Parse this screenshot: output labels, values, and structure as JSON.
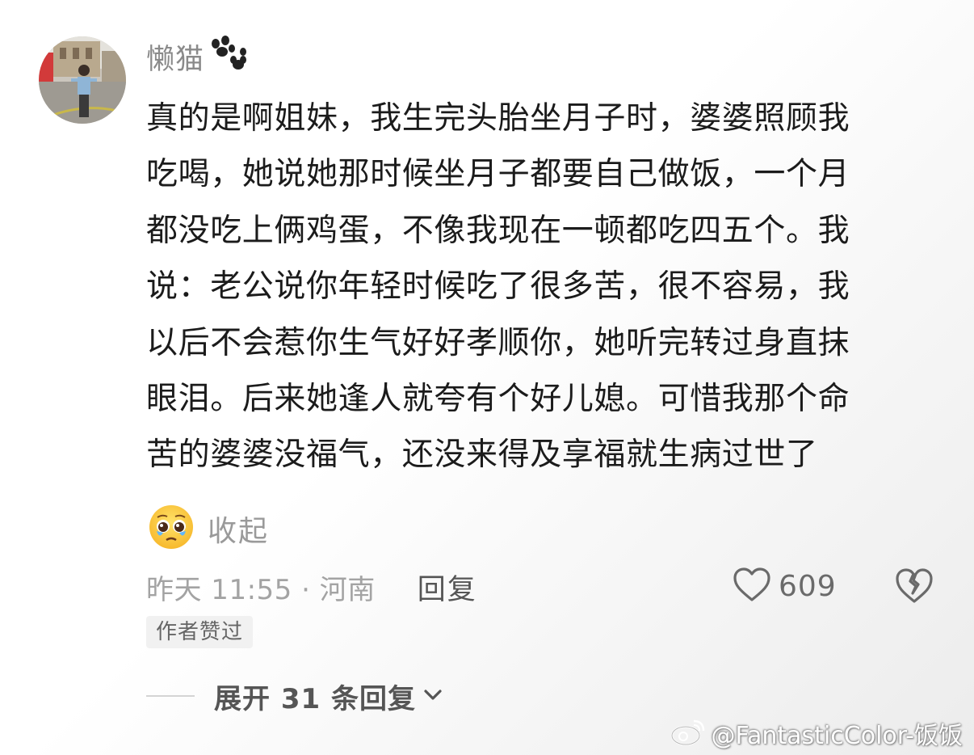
{
  "comment": {
    "username": "懒猫",
    "username_emoji": "paw-icon",
    "text_lines": [
      "真的是啊姐妹，我生完头胎坐月子时，婆婆照顾我",
      "吃喝，她说她那时候坐月子都要自己做饭，一个月",
      "都没吃上俩鸡蛋，不像我现在一顿都吃四五个。我",
      "说：老公说你年轻时候吃了很多苦，很不容易，我",
      "以后不会惹你生气好好孝顺你，她听完转过身直抹",
      "眼泪。后来她逢人就夸有个好儿媳。可惜我那个命",
      "苦的婆婆没福气，还没来得及享福就生病过世了"
    ],
    "trailing_emoji": "pleading-face-icon",
    "collapse_label": "收起",
    "meta": "昨天 11:55 · 河南",
    "reply_label": "回复",
    "like_count": "609",
    "author_badge": "作者赞过",
    "expand_label": "展开 31 条回复"
  },
  "watermark": {
    "text": "@FantasticColor-饭饭"
  },
  "colors": {
    "username": "#8a8a8a",
    "body_text": "#1b1b1b",
    "meta": "#a3a3a3",
    "action": "#555555",
    "badge_bg": "#f1f1f1"
  }
}
